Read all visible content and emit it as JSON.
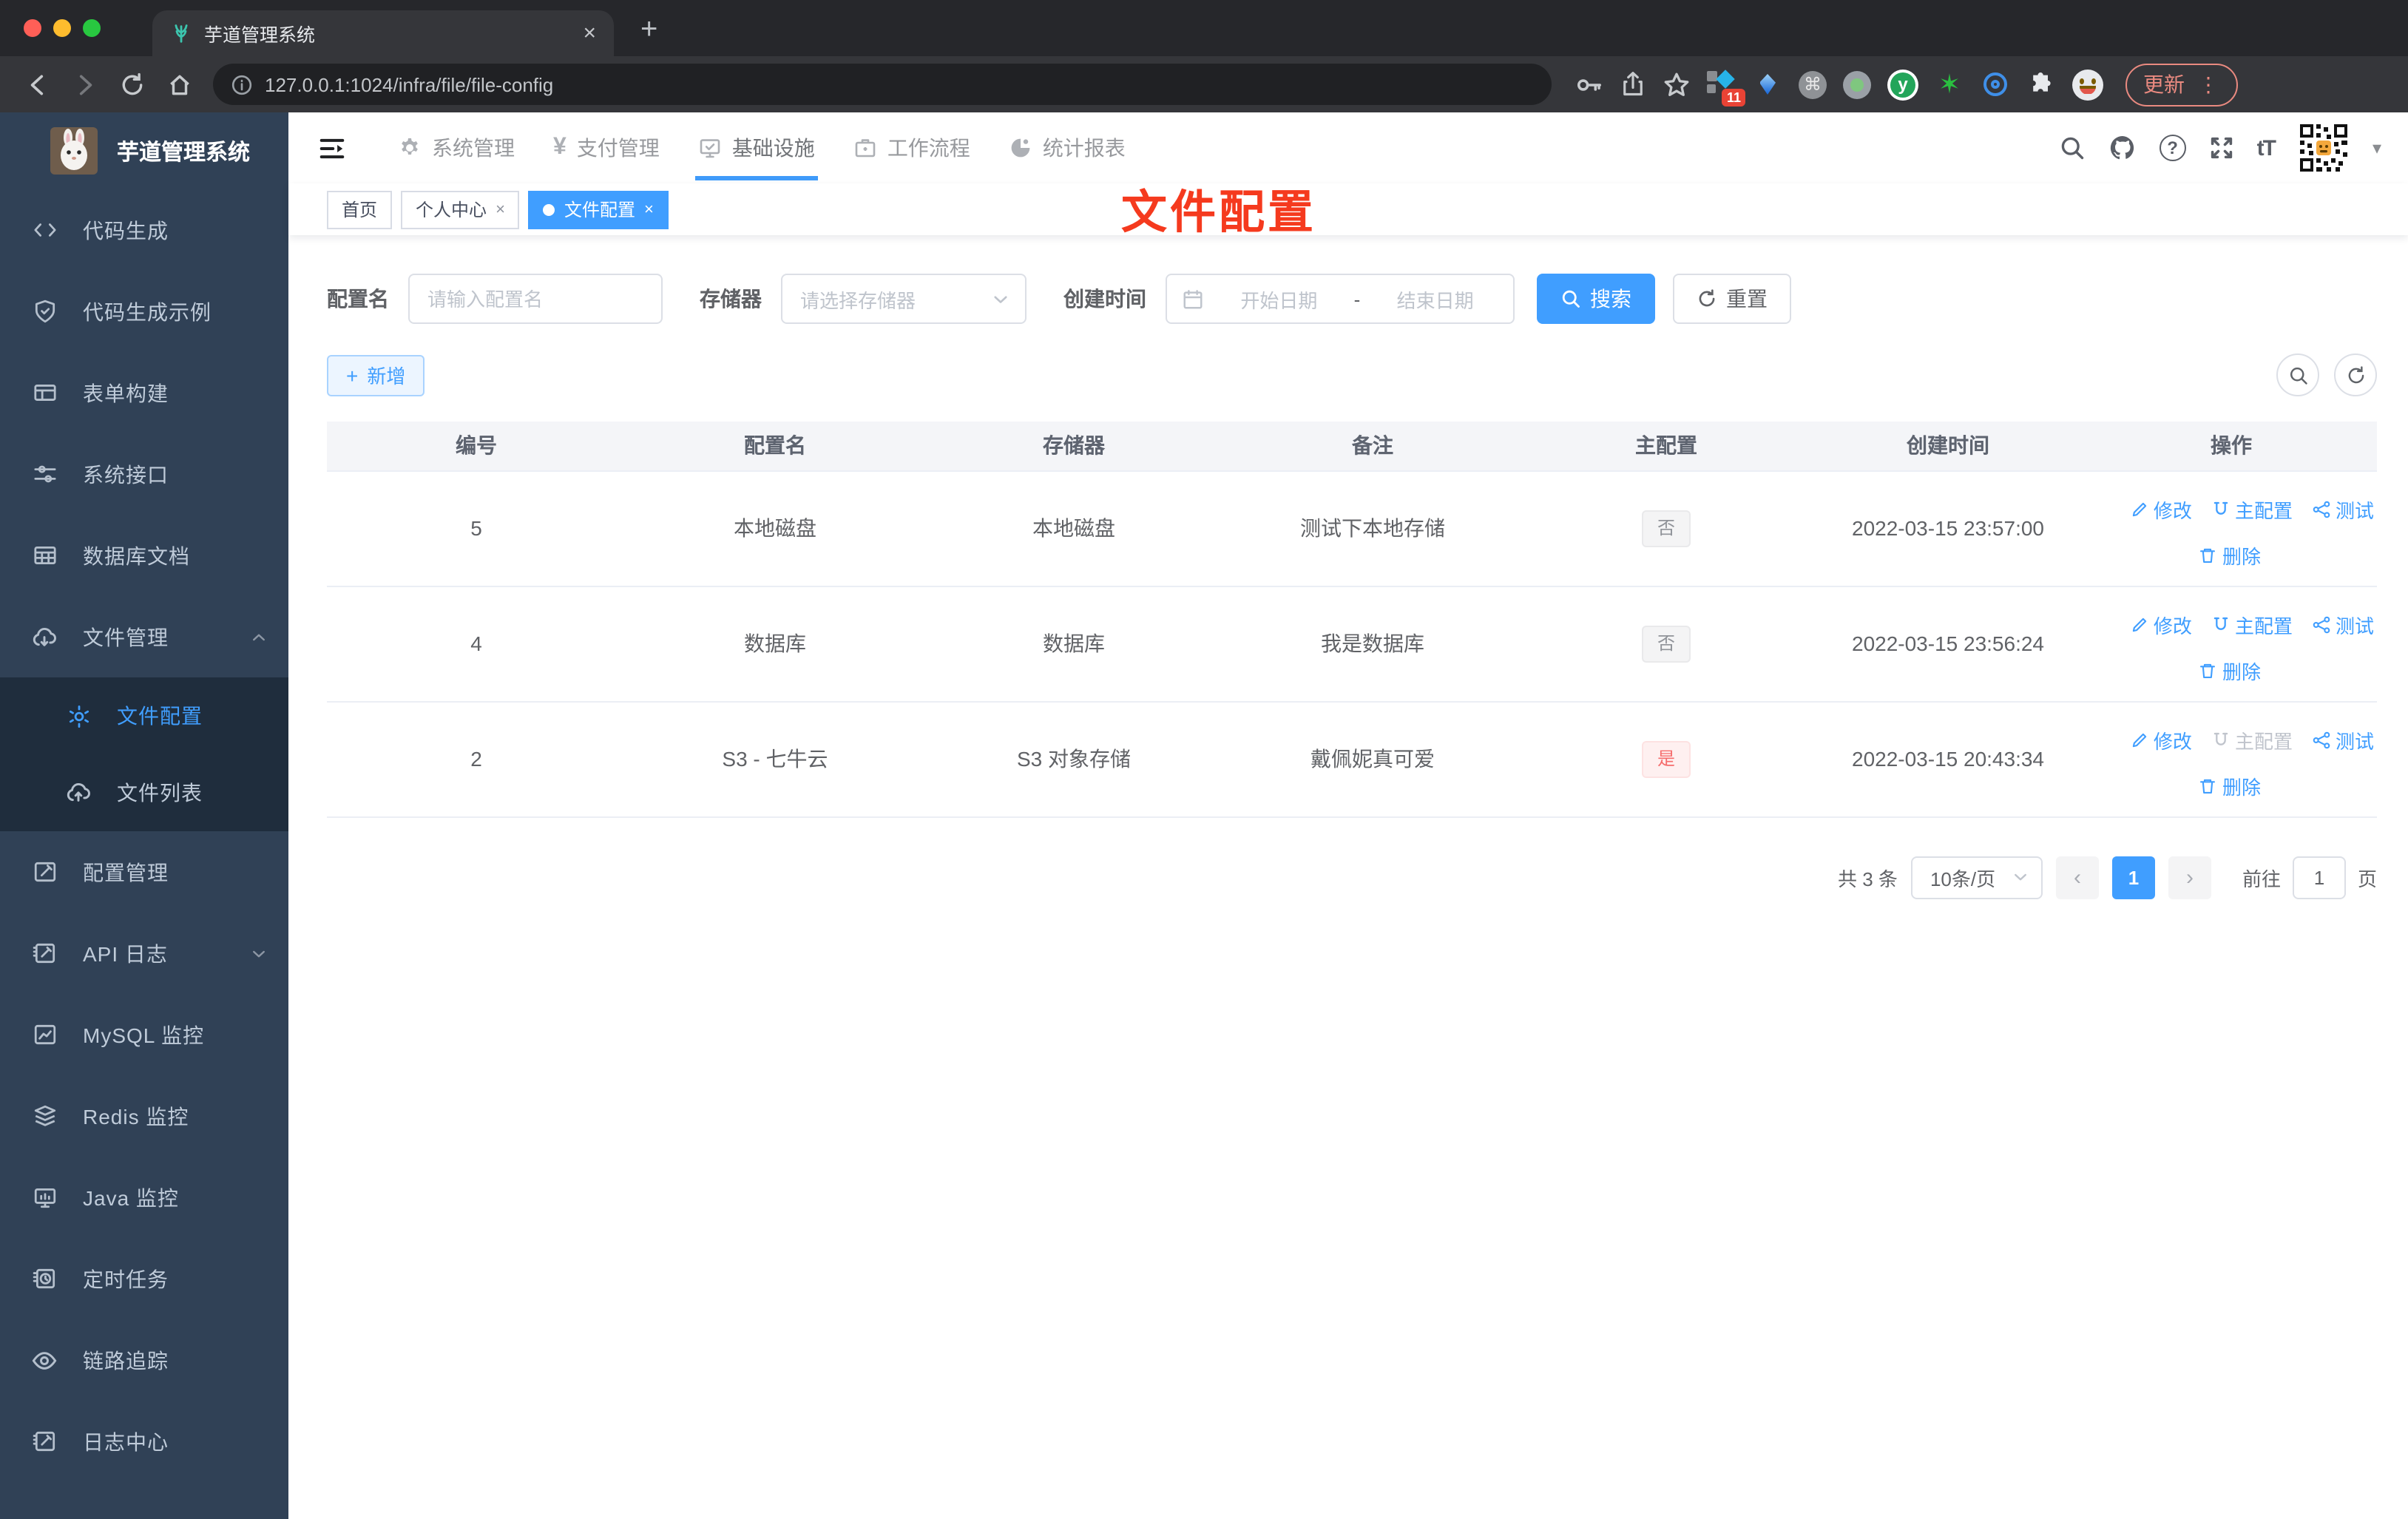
{
  "browser": {
    "tab_title": "芋道管理系统",
    "url": "127.0.0.1:1024/infra/file/file-config",
    "extension_badge": "11",
    "update_label": "更新"
  },
  "icons": {
    "close": "×",
    "plus": "+",
    "dots_vertical": "⋮",
    "yen": "¥",
    "question": "?",
    "font_size": "tT",
    "caret_down": "▾",
    "letter_y": "y",
    "star": "✶",
    "chevron_prev": "‹",
    "chevron_next": "›"
  },
  "sidebar": {
    "title": "芋道管理系统",
    "items": [
      {
        "label": "代码生成"
      },
      {
        "label": "代码生成示例"
      },
      {
        "label": "表单构建"
      },
      {
        "label": "系统接口"
      },
      {
        "label": "数据库文档"
      },
      {
        "label": "文件管理"
      },
      {
        "label": "文件配置"
      },
      {
        "label": "文件列表"
      },
      {
        "label": "配置管理"
      },
      {
        "label": "API 日志"
      },
      {
        "label": "MySQL 监控"
      },
      {
        "label": "Redis 监控"
      },
      {
        "label": "Java 监控"
      },
      {
        "label": "定时任务"
      },
      {
        "label": "链路追踪"
      },
      {
        "label": "日志中心"
      }
    ]
  },
  "topnav": {
    "items": [
      "系统管理",
      "支付管理",
      "基础设施",
      "工作流程",
      "统计报表"
    ]
  },
  "tags": {
    "items": [
      {
        "label": "首页"
      },
      {
        "label": "个人中心"
      },
      {
        "label": "文件配置"
      }
    ]
  },
  "annotation": {
    "text": "文件配置"
  },
  "filters": {
    "name_label": "配置名",
    "name_placeholder": "请输入配置名",
    "storage_label": "存储器",
    "storage_placeholder": "请选择存储器",
    "date_label": "创建时间",
    "date_start_placeholder": "开始日期",
    "date_separator": "-",
    "date_end_placeholder": "结束日期",
    "search_label": "搜索",
    "reset_label": "重置"
  },
  "toolbar": {
    "add_label": "新增"
  },
  "table": {
    "headers": [
      "编号",
      "配置名",
      "存储器",
      "备注",
      "主配置",
      "创建时间",
      "操作"
    ],
    "rows": [
      {
        "id": "5",
        "name": "本地磁盘",
        "storage": "本地磁盘",
        "remark": "测试下本地存储",
        "master": "否",
        "created": "2022-03-15 23:57:00"
      },
      {
        "id": "4",
        "name": "数据库",
        "storage": "数据库",
        "remark": "我是数据库",
        "master": "否",
        "created": "2022-03-15 23:56:24"
      },
      {
        "id": "2",
        "name": "S3 - 七牛云",
        "storage": "S3 对象存储",
        "remark": "戴佩妮真可爱",
        "master": "是",
        "created": "2022-03-15 20:43:34"
      }
    ],
    "actions": {
      "edit": "修改",
      "master": "主配置",
      "test": "测试",
      "delete": "删除"
    }
  },
  "pagination": {
    "total": "共 3 条",
    "page_size": "10条/页",
    "page": "1",
    "goto_label": "前往",
    "goto_value": "1",
    "page_label": "页"
  },
  "colors": {
    "accent": "#409eff",
    "danger": "#f56c6c",
    "annotation_red": "#f53a1e",
    "sidebar_bg": "#304156",
    "submenu_bg": "#1f2d3d"
  }
}
